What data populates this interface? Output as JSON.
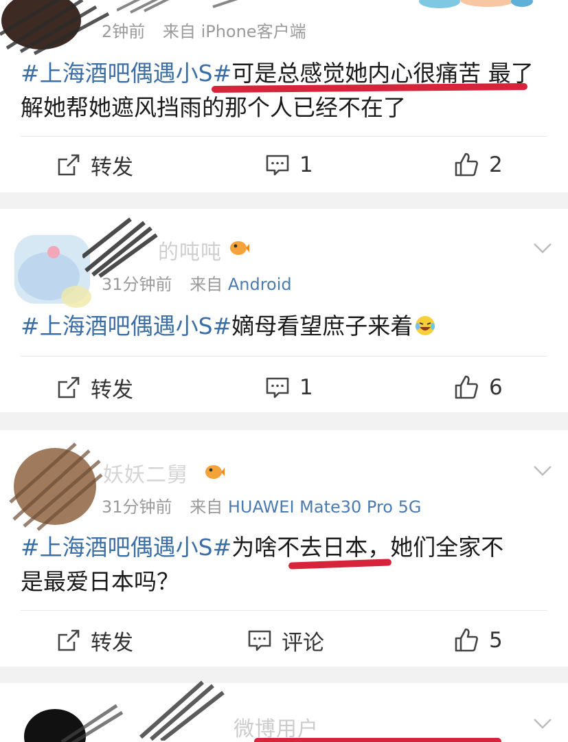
{
  "colors": {
    "hashtag": "#3a6ea5",
    "meta_text": "#9a9a9a",
    "underline_red": "#d6243a",
    "separator": "#f2f2f2"
  },
  "posts": [
    {
      "meta": {
        "time": "2",
        "time_suffix": "钟前",
        "source_prefix": "来自",
        "source": "iPhone客户端"
      },
      "hashtag": "#上海酒吧偶遇小S#",
      "text": "可是总感觉她内心很痛苦 最了解她帮她遮风挡雨的那个人已经不在了",
      "actions": {
        "repost": "转发",
        "comment": "1",
        "like": "2"
      }
    },
    {
      "username": "的吨吨",
      "meta": {
        "time": "31分钟前",
        "source_prefix": "来自",
        "source": "Android"
      },
      "hashtag": "#上海酒吧偶遇小S#",
      "text": "嫡母看望庶子来着",
      "actions": {
        "repost": "转发",
        "comment": "1",
        "like": "6"
      }
    },
    {
      "username": "妖妖二舅",
      "meta": {
        "time": "31分钟前",
        "source_prefix": "来自",
        "source": "HUAWEI Mate30 Pro 5G"
      },
      "hashtag": "#上海酒吧偶遇小S#",
      "text_line1": "为啥不去日本，她们全家不",
      "text_line2": "是最爱日本吗？",
      "actions": {
        "repost": "转发",
        "comment": "评论",
        "like": "5"
      }
    },
    {
      "username": "微博用户"
    }
  ],
  "icons": [
    "repost-icon",
    "comment-icon",
    "like-icon",
    "chevron-down-icon",
    "fish-badge-icon",
    "laugh-cry-emoji"
  ]
}
